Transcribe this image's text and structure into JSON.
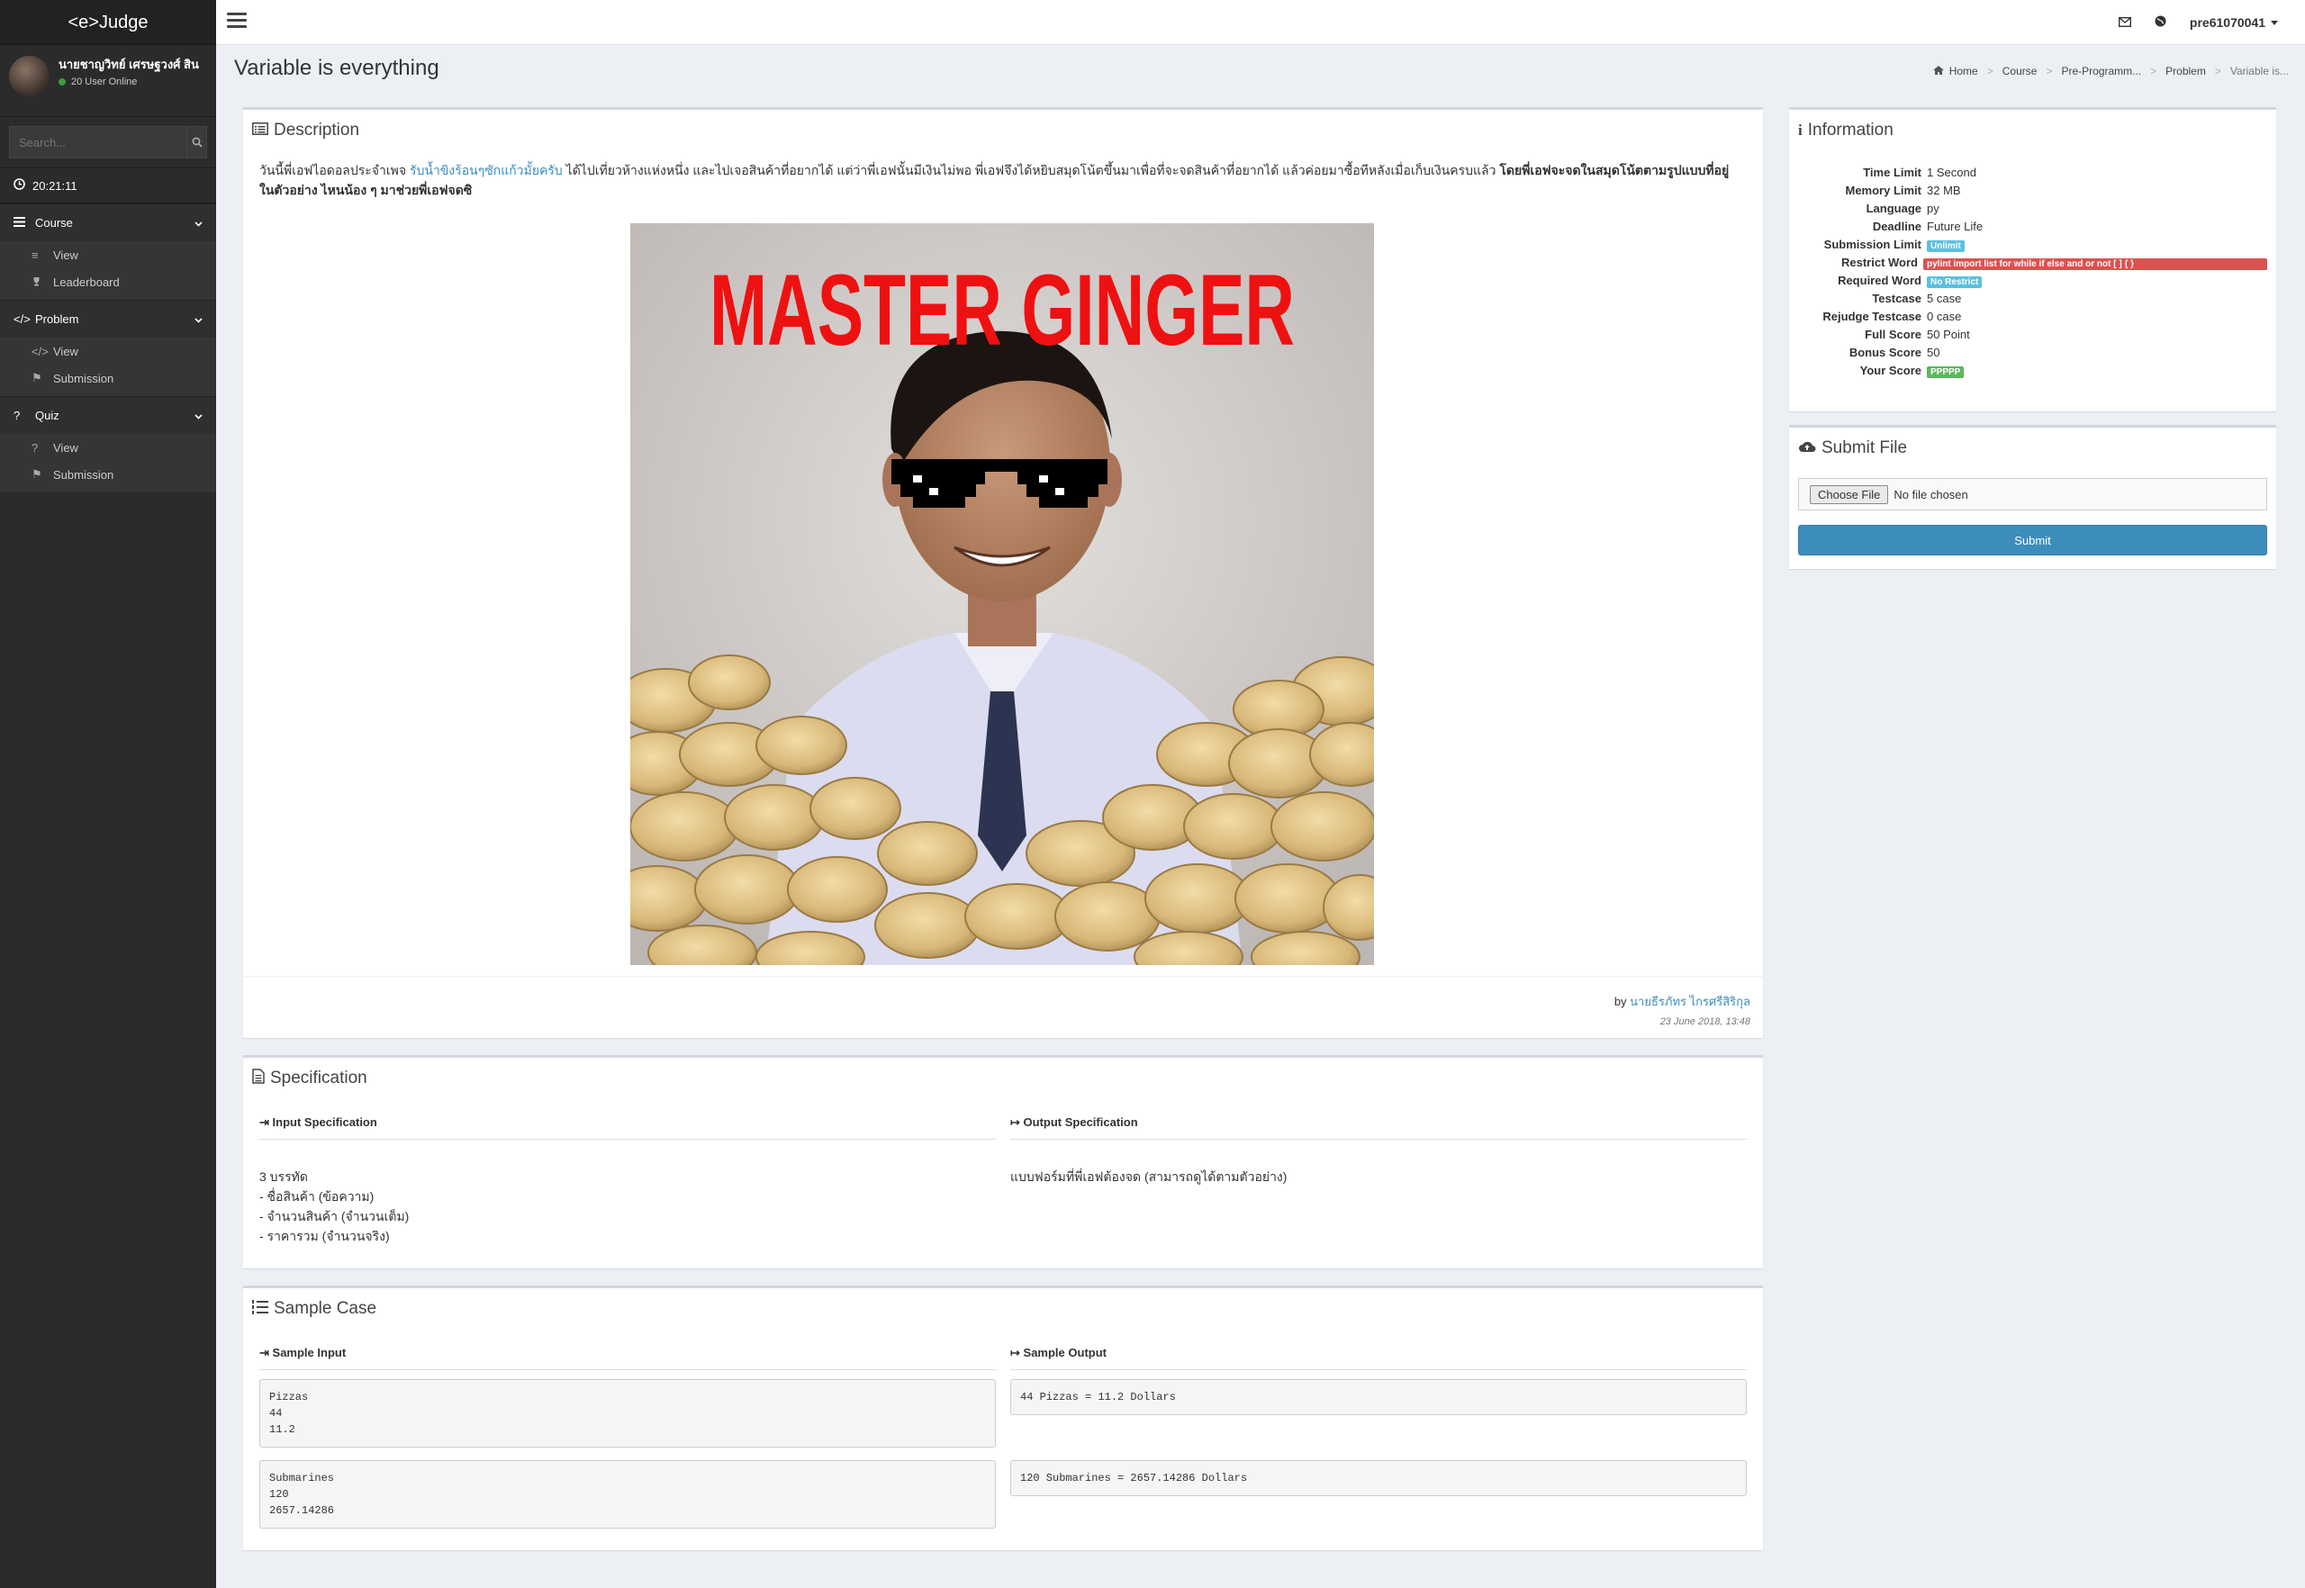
{
  "brand": "<e>Judge",
  "user": {
    "name": "นายชาญวิทย์ เศรษฐวงศ์ สิน",
    "online": "20 User Online"
  },
  "search": {
    "placeholder": "Search..."
  },
  "clock": "20:21:11",
  "menu": {
    "course": {
      "label": "Course",
      "items": [
        "View",
        "Leaderboard"
      ]
    },
    "problem": {
      "label": "Problem",
      "items": [
        "View",
        "Submission"
      ]
    },
    "quiz": {
      "label": "Quiz",
      "items": [
        "View",
        "Submission"
      ]
    }
  },
  "topbar": {
    "username": "pre61070041"
  },
  "page": {
    "title": "Variable is everything"
  },
  "breadcrumb": [
    "Home",
    "Course",
    "Pre-Programm...",
    "Problem",
    "Variable is..."
  ],
  "description": {
    "title": "Description",
    "text_1": "วันนี้พี่เอฟไอดอลประจำเพจ ",
    "link": "รับน้ำขิงร้อนๆซักแก้วมั้ยครับ",
    "text_2": " ได้ไปเที่ยวห้างแห่งหนึ่ง และไปเจอสินค้าที่อยากได้ แต่ว่าพี่เอฟนั้นมีเงินไม่พอ พี่เอฟจึงได้หยิบสมุดโน้ตขึ้นมาเพื่อที่จะจดสินค้าที่อยากได้ แล้วค่อยมาซื้อทีหลังเมื่อเก็บเงินครบแล้ว ",
    "text_bold": "โดยพี่เอฟจะจดในสมุดโน้ตตามรูปแบบที่อยู่ในตัวอย่าง ไหนน้อง ๆ มาช่วยพี่เอฟจดซิ",
    "image_caption": "MASTER GINGER",
    "author_prefix": "by ",
    "author": "นายธีรภัทร ไกรศรีสิริกุล",
    "date": "23 June 2018, 13:48"
  },
  "specification": {
    "title": "Specification",
    "input_head": "Input Specification",
    "output_head": "Output Specification",
    "input_body": "3 บรรทัด\n- ชื่อสินค้า (ข้อความ)\n- จำนวนสินค้า (จำนวนเต็ม)\n- ราคารวม (จำนวนจริง)",
    "output_body": "แบบฟอร์มที่พี่เอฟต้องจด (สามารถดูได้ตามตัวอย่าง)"
  },
  "sample": {
    "title": "Sample Case",
    "input_head": "Sample Input",
    "output_head": "Sample Output",
    "cases": [
      {
        "input": "Pizzas\n44\n11.2",
        "output": "44 Pizzas = 11.2 Dollars"
      },
      {
        "input": "Submarines\n120\n2657.14286",
        "output": "120 Submarines = 2657.14286 Dollars"
      }
    ]
  },
  "information": {
    "title": "Information",
    "rows": [
      {
        "label": "Time Limit",
        "value": "1 Second"
      },
      {
        "label": "Memory Limit",
        "value": "32 MB"
      },
      {
        "label": "Language",
        "value": "py"
      },
      {
        "label": "Deadline",
        "value": "Future Life"
      },
      {
        "label": "Submission Limit",
        "value": "Unlimit"
      },
      {
        "label": "Restrict Word",
        "value": "pylint import list for while if else and or not [ ] { }"
      },
      {
        "label": "Required Word",
        "value": "No Restrict"
      },
      {
        "label": "Testcase",
        "value": "5 case"
      },
      {
        "label": "Rejudge Testcase",
        "value": "0 case"
      },
      {
        "label": "Full Score",
        "value": "50 Point"
      },
      {
        "label": "Bonus Score",
        "value": "50"
      },
      {
        "label": "Your Score",
        "value": "PPPPP"
      }
    ]
  },
  "submit": {
    "title": "Submit File",
    "choose_label": "Choose File",
    "no_file": "No file chosen",
    "button": "Submit"
  },
  "colors": {
    "primary": "#3c8dbc",
    "sidebar": "#2b2b2b",
    "danger": "#d9534f",
    "info": "#5bc0de",
    "success": "#5cb85c"
  }
}
